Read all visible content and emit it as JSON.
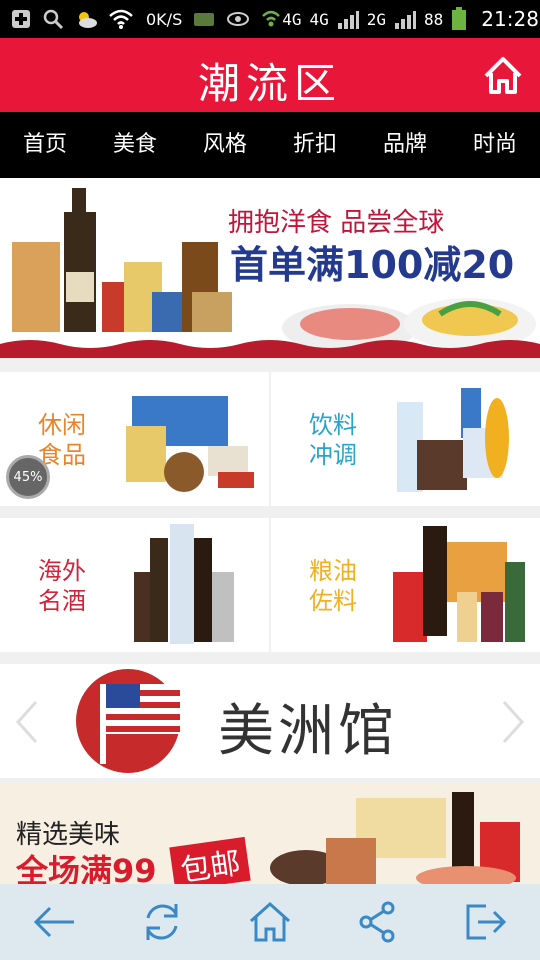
{
  "status_bar": {
    "speed": "0K/S",
    "network_1": "4G",
    "network_2": "4G",
    "network_3": "2G",
    "battery": "88",
    "time": "21:28"
  },
  "app": {
    "title": "潮流区"
  },
  "nav": {
    "items": [
      "首页",
      "美食",
      "风格",
      "折扣",
      "品牌",
      "时尚"
    ]
  },
  "banner": {
    "line1": "拥抱洋食 品尝全球",
    "line2": "首单满100减20"
  },
  "categories": [
    {
      "line1": "休闲",
      "line2": "食品",
      "color": "#e8842a"
    },
    {
      "line1": "饮料",
      "line2": "冲调",
      "color": "#2aa3c7"
    },
    {
      "line1": "海外",
      "line2": "名酒",
      "color": "#d0243a"
    },
    {
      "line1": "粮油",
      "line2": "佐料",
      "color": "#f0b020"
    }
  ],
  "floating_bubble": "45%",
  "pavilion": {
    "title": "美洲馆"
  },
  "promo": {
    "line1": "精选美味",
    "line2": "全场满99",
    "tag": "包邮"
  },
  "colors": {
    "brand_red": "#e8173a",
    "nav_bg": "#000000",
    "bottom_bar_bg": "#dde9ee",
    "icon_blue": "#3a88c6"
  }
}
